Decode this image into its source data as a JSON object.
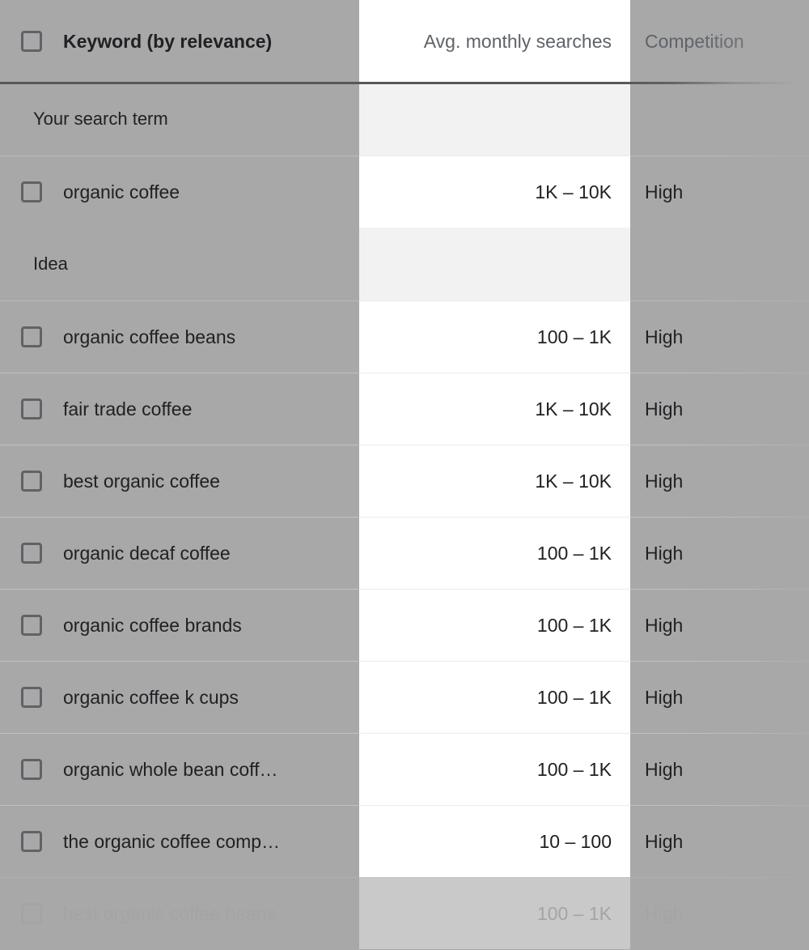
{
  "table": {
    "columns": {
      "keyword": "Keyword (by relevance)",
      "searches": "Avg. monthly searches",
      "competition": "Competition"
    },
    "groups": [
      {
        "label": "Your search term",
        "rows": [
          {
            "keyword": "organic coffee",
            "searches": "1K – 10K",
            "competition": "High",
            "faded": false
          }
        ]
      },
      {
        "label": "Idea",
        "rows": [
          {
            "keyword": "organic coffee beans",
            "searches": "100 – 1K",
            "competition": "High",
            "faded": false
          },
          {
            "keyword": "fair trade coffee",
            "searches": "1K – 10K",
            "competition": "High",
            "faded": false
          },
          {
            "keyword": "best organic coffee",
            "searches": "1K – 10K",
            "competition": "High",
            "faded": false
          },
          {
            "keyword": "organic decaf coffee",
            "searches": "100 – 1K",
            "competition": "High",
            "faded": false
          },
          {
            "keyword": "organic coffee brands",
            "searches": "100 – 1K",
            "competition": "High",
            "faded": false
          },
          {
            "keyword": "organic coffee k cups",
            "searches": "100 – 1K",
            "competition": "High",
            "faded": false
          },
          {
            "keyword": "organic whole bean coff…",
            "searches": "100 – 1K",
            "competition": "High",
            "faded": false
          },
          {
            "keyword": "the organic coffee comp…",
            "searches": "10 – 100",
            "competition": "High",
            "faded": false
          },
          {
            "keyword": "best organic coffee beans",
            "searches": "100 – 1K",
            "competition": "High",
            "faded": true
          }
        ]
      }
    ],
    "icons": {
      "select_all": "checkbox-icon",
      "row_select": "checkbox-icon"
    },
    "colors": {
      "background": "#a8a8a8",
      "searches_column": "#ffffff",
      "group_searches_column": "#f2f2f2",
      "text_primary": "#202124",
      "text_secondary": "#5f6368",
      "header_rule": "#555759"
    }
  }
}
